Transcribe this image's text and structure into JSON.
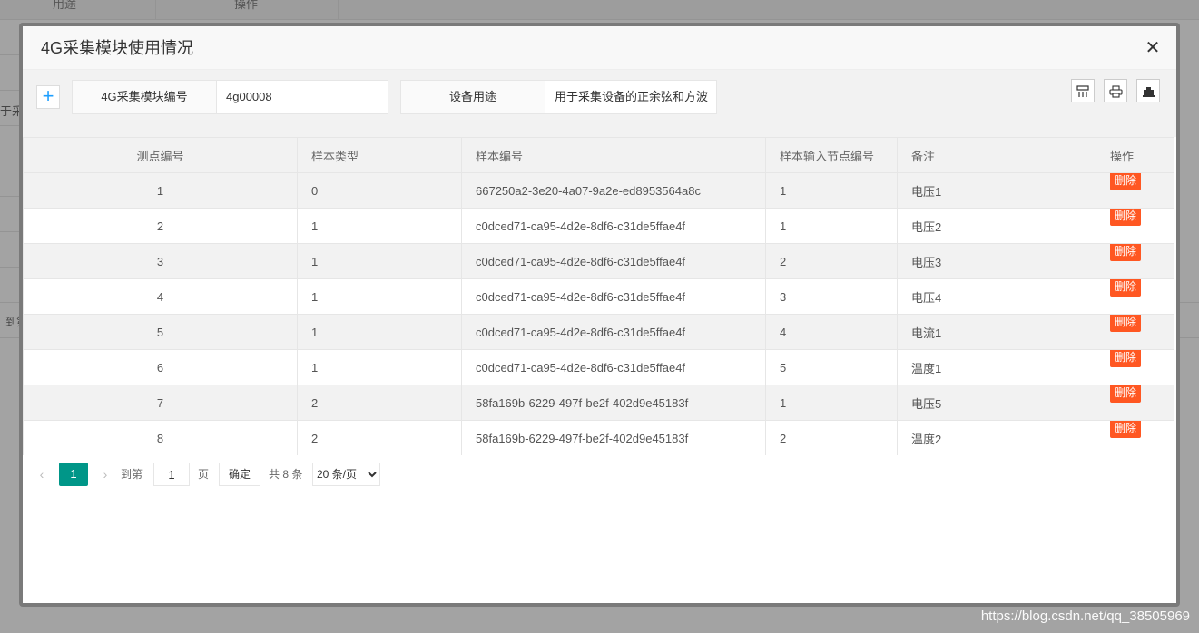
{
  "background": {
    "header_cols": [
      "用途",
      "操作"
    ],
    "left_fragments": [
      "于采",
      "到第"
    ]
  },
  "modal": {
    "title": "4G采集模块使用情况",
    "close_icon": "close-icon",
    "toolbar": {
      "add_icon": "plus-icon",
      "module_no_label": "4G采集模块编号",
      "module_no_value": "4g00008",
      "device_usage_label": "设备用途",
      "device_usage_value": "用于采集设备的正余弦和方波",
      "icons": [
        "columns-icon",
        "print-icon",
        "export-icon"
      ]
    },
    "table": {
      "columns": [
        "测点编号",
        "样本类型",
        "样本编号",
        "样本输入节点编号",
        "备注",
        "操作"
      ],
      "rows": [
        {
          "point": "1",
          "type": "0",
          "sample": "667250a2-3e20-4a07-9a2e-ed8953564a8c",
          "node": "1",
          "remark": "电压1"
        },
        {
          "point": "2",
          "type": "1",
          "sample": "c0dced71-ca95-4d2e-8df6-c31de5ffae4f",
          "node": "1",
          "remark": "电压2"
        },
        {
          "point": "3",
          "type": "1",
          "sample": "c0dced71-ca95-4d2e-8df6-c31de5ffae4f",
          "node": "2",
          "remark": "电压3"
        },
        {
          "point": "4",
          "type": "1",
          "sample": "c0dced71-ca95-4d2e-8df6-c31de5ffae4f",
          "node": "3",
          "remark": "电压4"
        },
        {
          "point": "5",
          "type": "1",
          "sample": "c0dced71-ca95-4d2e-8df6-c31de5ffae4f",
          "node": "4",
          "remark": "电流1"
        },
        {
          "point": "6",
          "type": "1",
          "sample": "c0dced71-ca95-4d2e-8df6-c31de5ffae4f",
          "node": "5",
          "remark": "温度1"
        },
        {
          "point": "7",
          "type": "2",
          "sample": "58fa169b-6229-497f-be2f-402d9e45183f",
          "node": "1",
          "remark": "电压5"
        },
        {
          "point": "8",
          "type": "2",
          "sample": "58fa169b-6229-497f-be2f-402d9e45183f",
          "node": "2",
          "remark": "温度2"
        }
      ],
      "delete_label": "删除"
    },
    "pager": {
      "current_page": "1",
      "goto_label": "到第",
      "goto_value": "1",
      "page_label": "页",
      "confirm_label": "确定",
      "total_label": "共 8 条",
      "page_size_selected": "20 条/页",
      "accent_color": "#009688"
    }
  },
  "watermark": "https://blog.csdn.net/qq_38505969"
}
